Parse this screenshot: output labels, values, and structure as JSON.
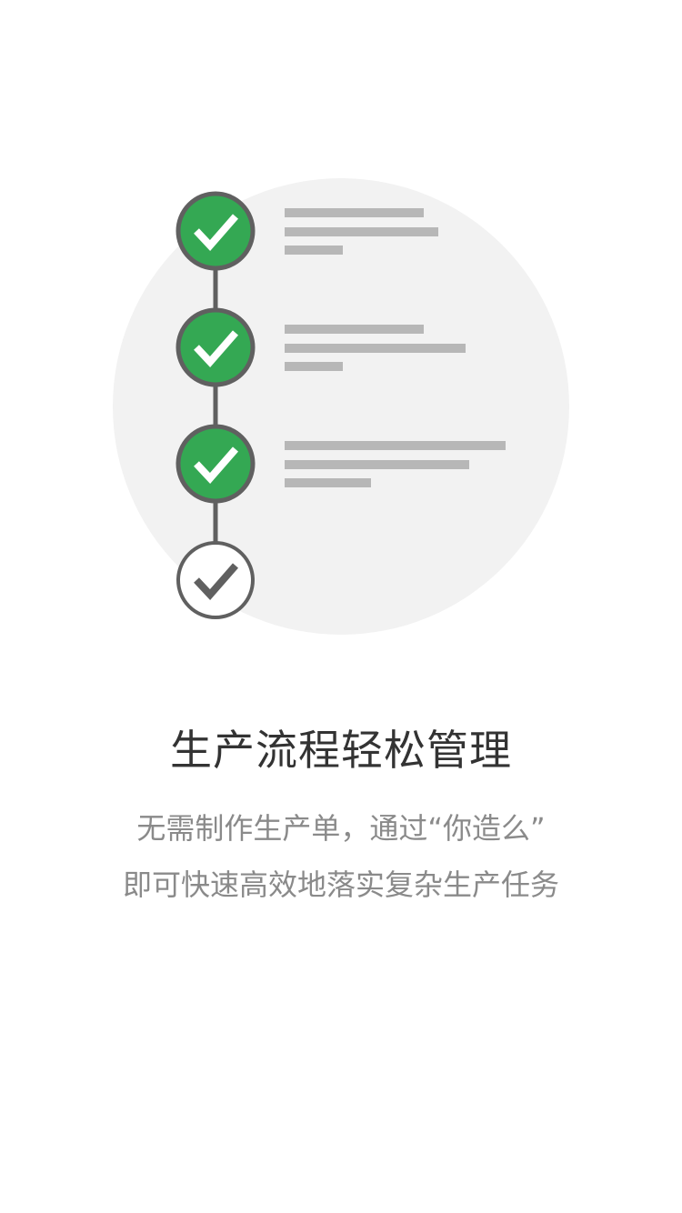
{
  "onboarding": {
    "title": "生产流程轻松管理",
    "description_line1": "无需制作生产单，通过“你造么”",
    "description_line2": "即可快速高效地落实复杂生产任务"
  },
  "illustration": {
    "steps": [
      {
        "state": "completed",
        "icon": "check-icon"
      },
      {
        "state": "completed",
        "icon": "check-icon"
      },
      {
        "state": "completed",
        "icon": "check-icon"
      },
      {
        "state": "pending",
        "icon": "check-icon"
      }
    ],
    "colors": {
      "completed_fill": "#34a853",
      "ring": "#606060",
      "pending_fill": "#ffffff",
      "background_circle": "#f2f2f2",
      "text_bar": "#b7b7b7"
    }
  }
}
